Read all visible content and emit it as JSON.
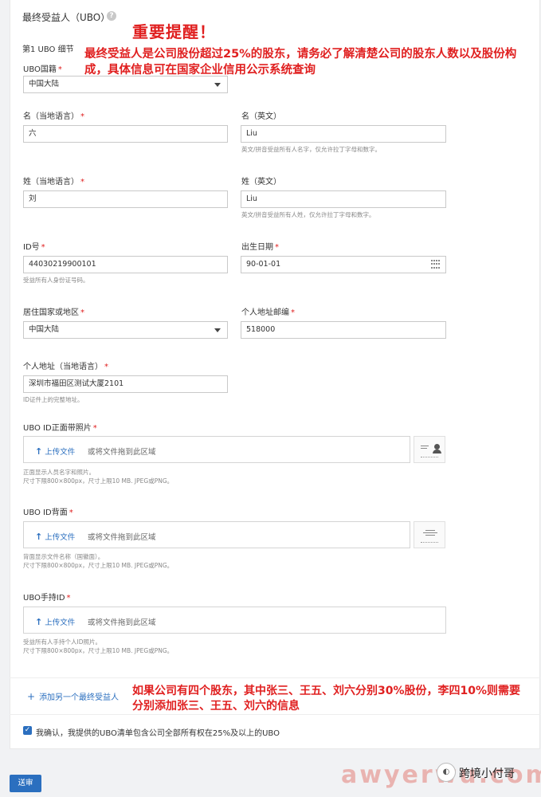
{
  "header": {
    "title": "最终受益人（UBO）"
  },
  "warning": {
    "title": "重要提醒！",
    "body": "最终受益人是公司股份超过25%的股东，请务必了解清楚公司的股东人数以及股份构成，具体信息可在国家企业信用公示系统查询"
  },
  "section_title": "第1 UBO 细节",
  "fields": {
    "nationality": {
      "label": "UBO国籍",
      "value": "中国大陆"
    },
    "first_name_local": {
      "label": "名（当地语言）",
      "value": "六"
    },
    "first_name_en": {
      "label": "名（英文）",
      "value": "Liu",
      "hint": "英文/拼音受益所有人名字，仅允许拉丁字母和数字。"
    },
    "last_name_local": {
      "label": "姓（当地语言）",
      "value": "刘"
    },
    "last_name_en": {
      "label": "姓（英文）",
      "value": "Liu",
      "hint": "英文/拼音受益所有人姓，仅允许拉丁字母和数字。"
    },
    "id_number": {
      "label": "ID号",
      "value": "44030219900101",
      "hint": "受益所有人身份证号码。"
    },
    "birth_date": {
      "label": "出生日期",
      "value": "90-01-01"
    },
    "residence": {
      "label": "居住国家或地区",
      "value": "中国大陆"
    },
    "postcode": {
      "label": "个人地址邮编",
      "value": "518000"
    },
    "address": {
      "label": "个人地址（当地语言）",
      "value": "深圳市福田区测试大厦2101",
      "hint": "ID证件上的完整地址。"
    }
  },
  "uploads": {
    "front": {
      "label": "UBO ID正面带照片",
      "button": "上传文件",
      "drop": "或将文件拖到此区域",
      "hint1": "正面显示人员名字和照片。",
      "hint2": "尺寸下限800×800px，尺寸上限10 MB. JPEG或PNG。"
    },
    "back": {
      "label": "UBO ID背面",
      "button": "上传文件",
      "drop": "或将文件拖到此区域",
      "hint1": "背面显示文件名称（国徽面）。",
      "hint2": "尺寸下限800×800px，尺寸上限10 MB. JPEG或PNG。"
    },
    "handheld": {
      "label": "UBO手持ID",
      "button": "上传文件",
      "drop": "或将文件拖到此区域",
      "hint1": "受益所有人手持个人ID照片。",
      "hint2": "尺寸下限800×800px，尺寸上限10 MB. JPEG或PNG。"
    }
  },
  "add_link": "添加另一个最终受益人",
  "add_note": "如果公司有四个股东，其中张三、王五、刘六分别30%股份，李四10%则需要分别添加张三、王五、刘六的信息",
  "confirm_text": "我确认，我提供的UBO清单包含公司全部所有权在25%及以上的UBO",
  "submit_label": "送审",
  "watermark": {
    "site": "awyerwu.com",
    "name": "跨境小付哥"
  },
  "colors": {
    "accent": "#2b6fbf",
    "warning": "#e02020"
  }
}
